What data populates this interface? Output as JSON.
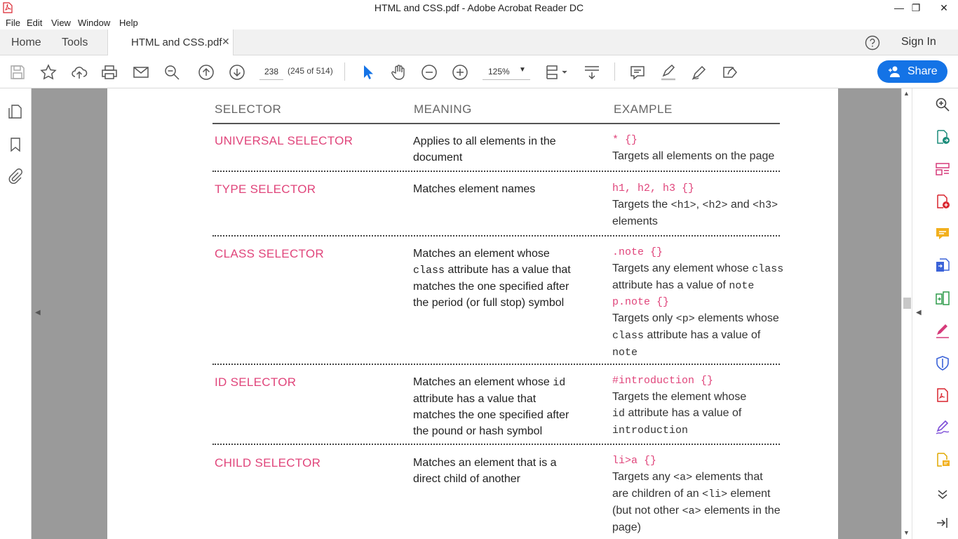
{
  "window": {
    "title": "HTML and CSS.pdf - Adobe Acrobat Reader DC",
    "minimize": "—",
    "restore": "❐",
    "close": "✕"
  },
  "menu": {
    "items": [
      "File",
      "Edit",
      "View",
      "Window",
      "Help"
    ]
  },
  "tabs": {
    "home": "Home",
    "tools": "Tools",
    "document": "HTML and CSS.pdf",
    "close": "✕",
    "sign_in": "Sign In"
  },
  "toolbar": {
    "page_number": "238",
    "page_count": "(245 of 514)",
    "zoom": "125%",
    "zoom_arrow": "▼",
    "share_label": "Share"
  },
  "document": {
    "headers": {
      "selector": "SELECTOR",
      "meaning": "MEANING",
      "example": "EXAMPLE"
    },
    "rows": [
      {
        "selector": "UNIVERSAL SELECTOR",
        "meaning": "Applies to all elements in the document",
        "code": "* {}",
        "example": "Targets all elements on the page"
      },
      {
        "selector": "TYPE SELECTOR",
        "meaning": "Matches element names",
        "code": "h1, h2, h3 {}",
        "example_parts": [
          "Targets the ",
          "<h1>",
          ", ",
          "<h2>",
          " and ",
          "<h3>",
          " elements"
        ]
      },
      {
        "selector": "CLASS SELECTOR",
        "meaning_parts": [
          "Matches an element whose ",
          "class",
          " attribute has a value that matches the one specified after the period (or full stop) symbol"
        ],
        "code": ".note {}",
        "example_parts": [
          "Targets any element whose ",
          "class",
          " attribute has a value of ",
          "note"
        ],
        "code2": "p.note {}",
        "example2_parts": [
          "Targets only ",
          "<p>",
          " elements whose ",
          "class",
          " attribute has a value of ",
          "note"
        ]
      },
      {
        "selector": "ID SELECTOR",
        "meaning_parts": [
          "Matches an element whose ",
          "id",
          " attribute has a value that matches the one specified after the pound or hash symbol"
        ],
        "code": "#introduction {}",
        "example_parts": [
          "Targets the element whose ",
          "id",
          " attribute has a value of ",
          "introduction"
        ]
      },
      {
        "selector": "CHILD SELECTOR",
        "meaning": "Matches an element that is a direct child of another",
        "code": "li>a {}",
        "example_parts": [
          "Targets any ",
          "<a>",
          " elements that are children of an ",
          "<li>",
          " element (but not other ",
          "<a>",
          " elements in the page)"
        ]
      }
    ]
  },
  "panes": {
    "collapse_left": "◀",
    "collapse_right": "◀",
    "scroll_up": "▲",
    "scroll_down": "▼"
  },
  "colors": {
    "accent_pink": "#e0457b",
    "share_blue": "#1473e6",
    "document_bg": "#9a9a9a"
  }
}
